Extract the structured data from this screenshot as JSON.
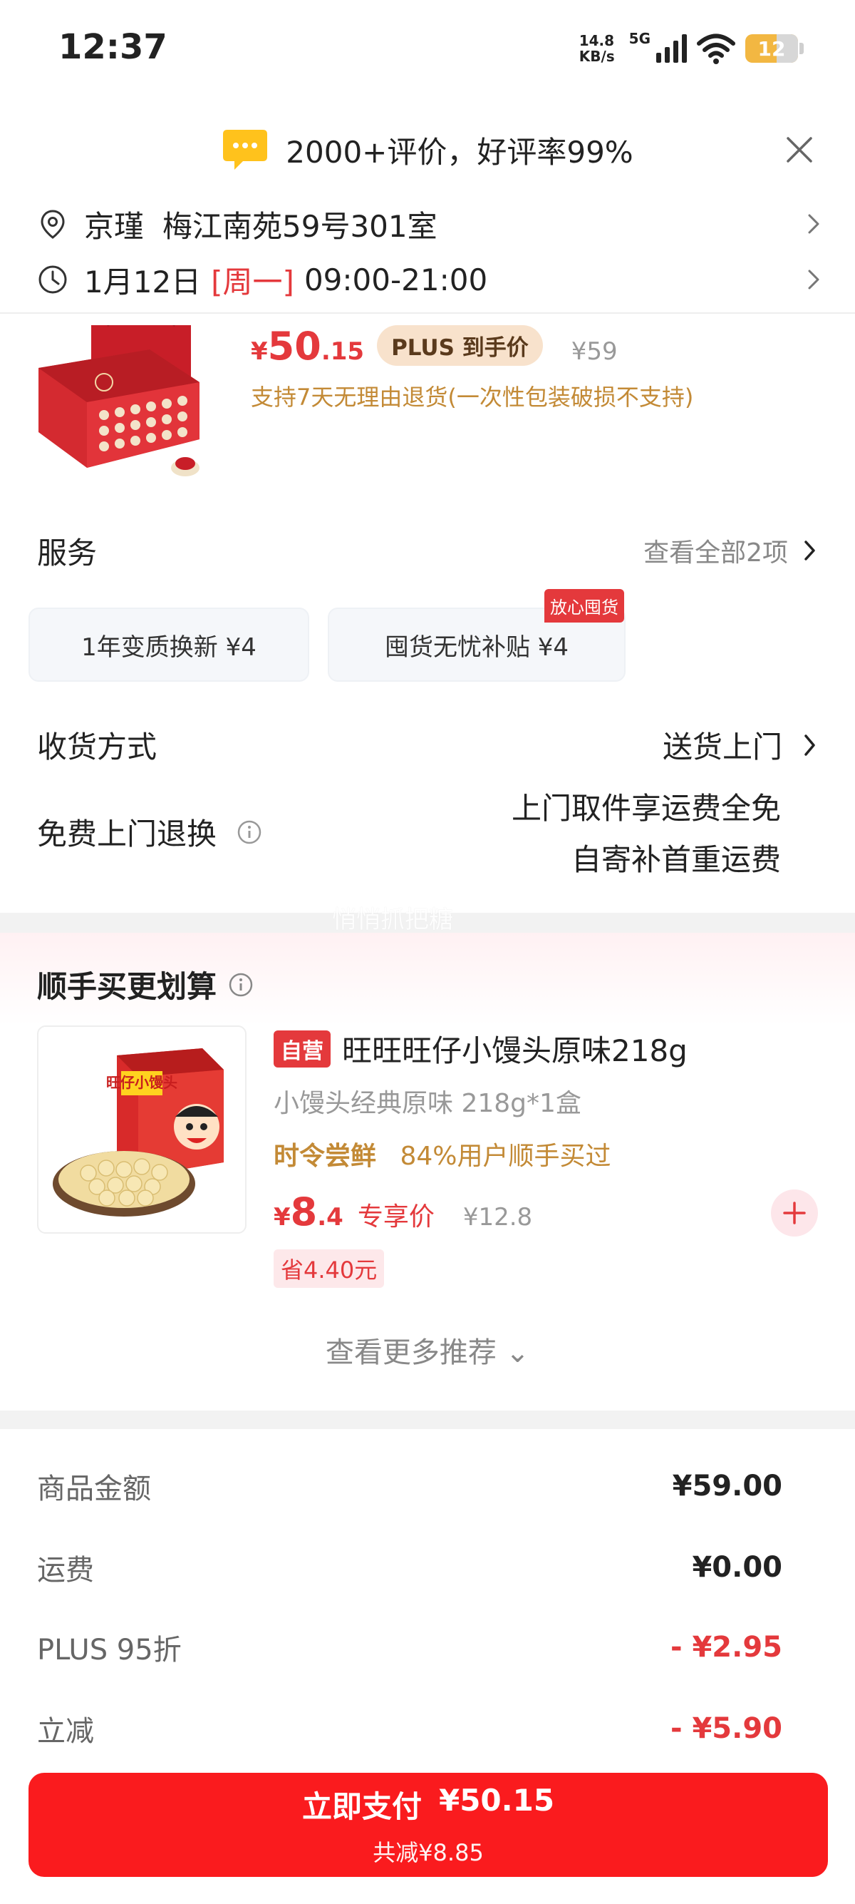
{
  "status_bar": {
    "time": "12:37",
    "net_speed_value": "14.8",
    "net_speed_unit": "KB/s",
    "network": "5G",
    "battery": "12"
  },
  "review_banner": {
    "text": "2000+评价，好评率99%"
  },
  "address": {
    "name": "京瑾",
    "detail": "梅江南苑59号301室"
  },
  "delivery_time": {
    "date": "1月12日",
    "weekday": "[周一]",
    "window": "09:00-21:00"
  },
  "product": {
    "price_symbol": "¥",
    "price_int": "50",
    "price_dec": ".15",
    "plus_label": "PLUS 到手价",
    "original_price": "¥59",
    "return_policy": "支持7天无理由退货(一次性包装破损不支持)"
  },
  "service": {
    "title": "服务",
    "view_all": "查看全部2项",
    "cards": [
      {
        "label": "1年变质换新  ¥4",
        "tag": ""
      },
      {
        "label": "囤货无忧补贴  ¥4",
        "tag": "放心囤货"
      }
    ]
  },
  "receive": {
    "title": "收货方式",
    "value": "送货上门"
  },
  "free_return": {
    "title": "免费上门退换",
    "line1": "上门取件享运费全免",
    "line2": "自寄补首重运费"
  },
  "watermark": "悄悄抓把糖",
  "recommend": {
    "title": "顺手买更划算",
    "item": {
      "badge": "自营",
      "name": "旺旺旺仔小馒头原味218g",
      "spec": "小馒头经典原味 218g*1盒",
      "tag_bold": "时令尝鲜",
      "tag_text": "84%用户顺手买过",
      "price_symbol": "¥",
      "price_int": "8",
      "price_dec": ".4",
      "price_label": "专享价",
      "original_price": "¥12.8",
      "save": "省4.40元",
      "box_text": "旺仔小馒头"
    },
    "more": "查看更多推荐 ⌄"
  },
  "summary": [
    {
      "label": "商品金额",
      "value": "¥59.00",
      "red": false
    },
    {
      "label": "运费",
      "value": "¥0.00",
      "red": false
    },
    {
      "label": "PLUS 95折",
      "value": "- ¥2.95",
      "red": true
    },
    {
      "label": "立减",
      "value": "- ¥5.90",
      "red": true
    }
  ],
  "pay": {
    "label": "立即支付",
    "amount": "¥50.15",
    "saved": "共减¥8.85"
  },
  "colors": {
    "accent_red": "#e4393c",
    "pay_red": "#fa1b1e",
    "gold": "#c38a36",
    "battery": "#f2b742"
  }
}
